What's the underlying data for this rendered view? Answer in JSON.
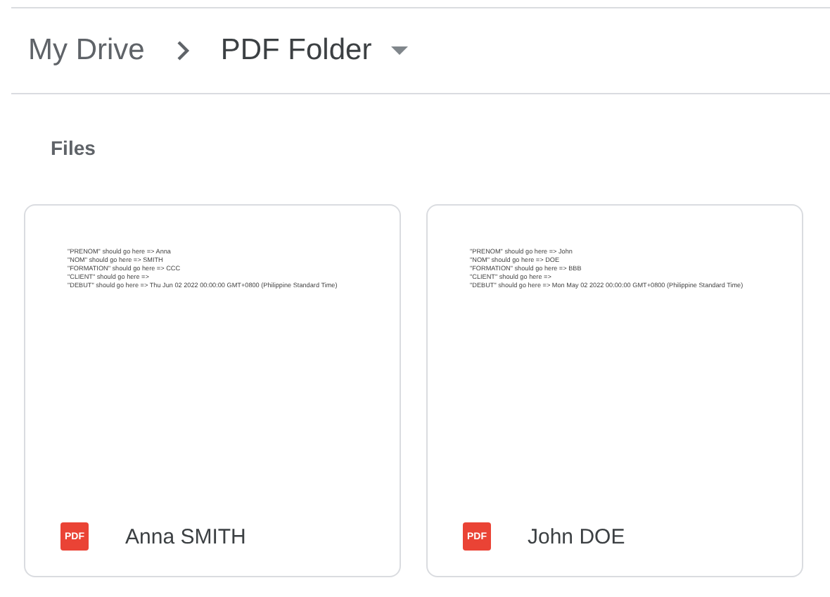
{
  "breadcrumb": [
    {
      "label": "My Drive"
    },
    {
      "label": "PDF Folder"
    }
  ],
  "section_title": "Files",
  "files": [
    {
      "name": "Anna SMITH",
      "icon_label": "PDF",
      "preview_lines": [
        "\"PRENOM\" should go here => Anna",
        "\"NOM\" should go here => SMITH",
        "\"FORMATION\" should go here => CCC",
        "\"CLIENT\" should go here =>",
        "\"DEBUT\" should go here => Thu Jun 02 2022 00:00:00 GMT+0800 (Philippine Standard Time)"
      ]
    },
    {
      "name": "John DOE",
      "icon_label": "PDF",
      "preview_lines": [
        "\"PRENOM\" should go here => John",
        "\"NOM\" should go here => DOE",
        "\"FORMATION\" should go here => BBB",
        "\"CLIENT\" should go here =>",
        "\"DEBUT\" should go here => Mon May 02 2022 00:00:00 GMT+0800 (Philippine Standard Time)"
      ]
    }
  ]
}
